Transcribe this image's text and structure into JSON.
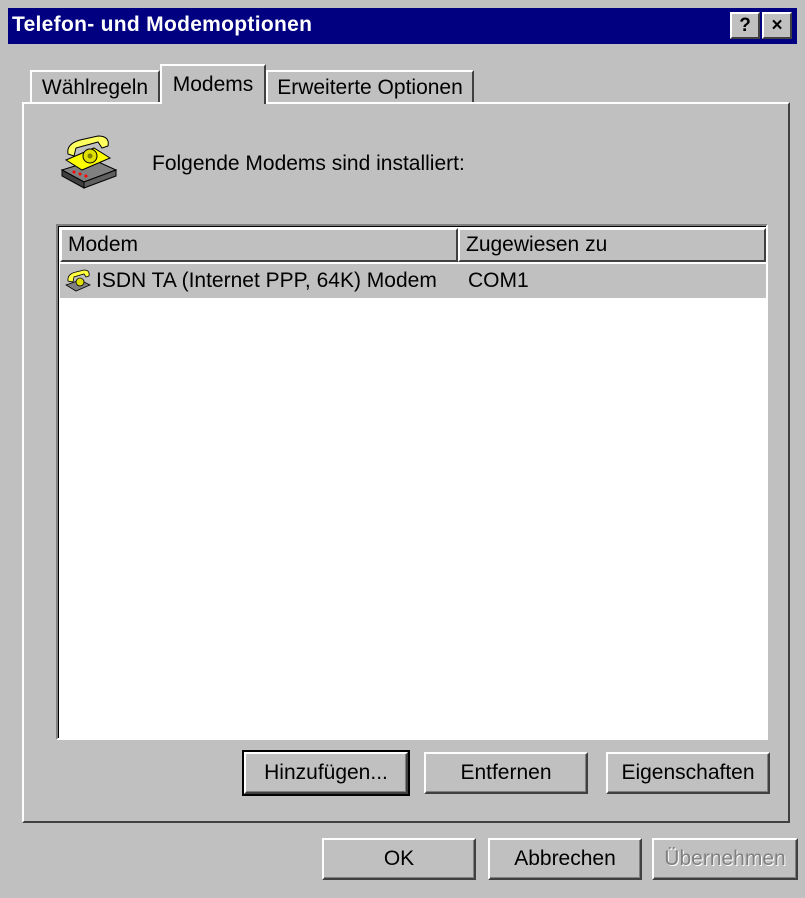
{
  "window": {
    "title": "Telefon- und Modemoptionen"
  },
  "titlebar": {
    "help_label": "?",
    "close_label": "×"
  },
  "tabs": [
    {
      "label": "Wählregeln"
    },
    {
      "label": "Modems"
    },
    {
      "label": "Erweiterte Optionen"
    }
  ],
  "active_tab": "Modems",
  "panel": {
    "intro_text": "Folgende Modems sind installiert:",
    "icon": "telephone-modem-icon"
  },
  "modem_list": {
    "columns": [
      {
        "label": "Modem"
      },
      {
        "label": "Zugewiesen zu"
      }
    ],
    "rows": [
      {
        "modem": "ISDN TA (Internet PPP, 64K) Modem",
        "port": "COM1",
        "selected": true
      }
    ]
  },
  "panel_buttons": {
    "add": "Hinzufügen...",
    "remove": "Entfernen",
    "properties": "Eigenschaften"
  },
  "dialog_buttons": {
    "ok": "OK",
    "cancel": "Abbrechen",
    "apply": "Übernehmen"
  },
  "colors": {
    "titlebar": "#000080",
    "face": "#c0c0c0",
    "selection": "#c0c0c0",
    "disabled_text": "#808080"
  }
}
